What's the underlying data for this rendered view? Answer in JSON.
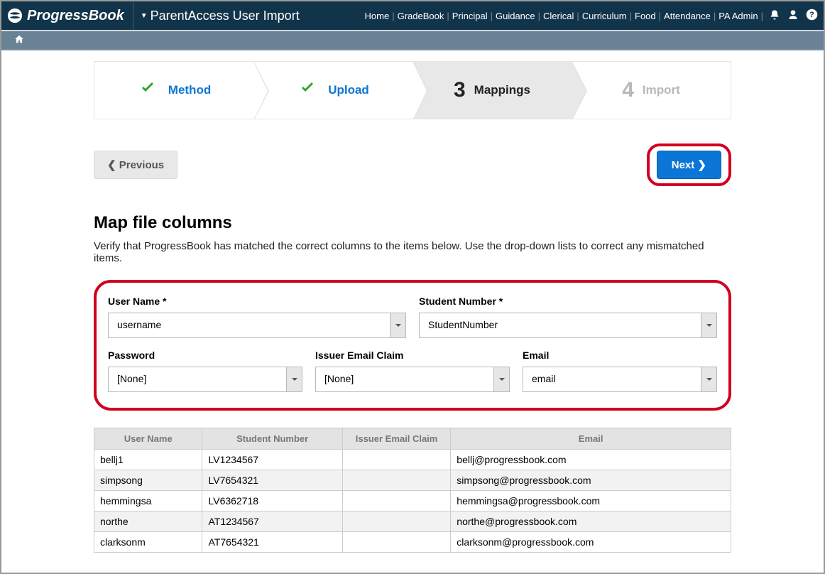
{
  "header": {
    "brand": "ProgressBook",
    "page_title": "ParentAccess User Import",
    "nav": [
      "Home",
      "GradeBook",
      "Principal",
      "Guidance",
      "Clerical",
      "Curriculum",
      "Food",
      "Attendance",
      "PA Admin"
    ]
  },
  "wizard": {
    "step1": "Method",
    "step2": "Upload",
    "step3_num": "3",
    "step3": "Mappings",
    "step4_num": "4",
    "step4": "Import"
  },
  "buttons": {
    "prev": "Previous",
    "next": "Next"
  },
  "section": {
    "title": "Map file columns",
    "help": "Verify that ProgressBook has matched the correct columns to the items below. Use the drop-down lists to correct any mismatched items."
  },
  "mapping": {
    "username_label": "User Name *",
    "username_value": "username",
    "studentnum_label": "Student Number *",
    "studentnum_value": "StudentNumber",
    "password_label": "Password",
    "password_value": "[None]",
    "issuer_label": "Issuer Email Claim",
    "issuer_value": "[None]",
    "email_label": "Email",
    "email_value": "email"
  },
  "table": {
    "headers": {
      "c1": "User Name",
      "c2": "Student Number",
      "c3": "Issuer Email Claim",
      "c4": "Email"
    },
    "rows": [
      {
        "c1": "bellj1",
        "c2": "LV1234567",
        "c3": "",
        "c4": "bellj@progressbook.com"
      },
      {
        "c1": "simpsong",
        "c2": "LV7654321",
        "c3": "",
        "c4": "simpsong@progressbook.com"
      },
      {
        "c1": "hemmingsa",
        "c2": "LV6362718",
        "c3": "",
        "c4": "hemmingsa@progressbook.com"
      },
      {
        "c1": "northe",
        "c2": "AT1234567",
        "c3": "",
        "c4": "northe@progressbook.com"
      },
      {
        "c1": "clarksonm",
        "c2": "AT7654321",
        "c3": "",
        "c4": "clarksonm@progressbook.com"
      }
    ]
  }
}
